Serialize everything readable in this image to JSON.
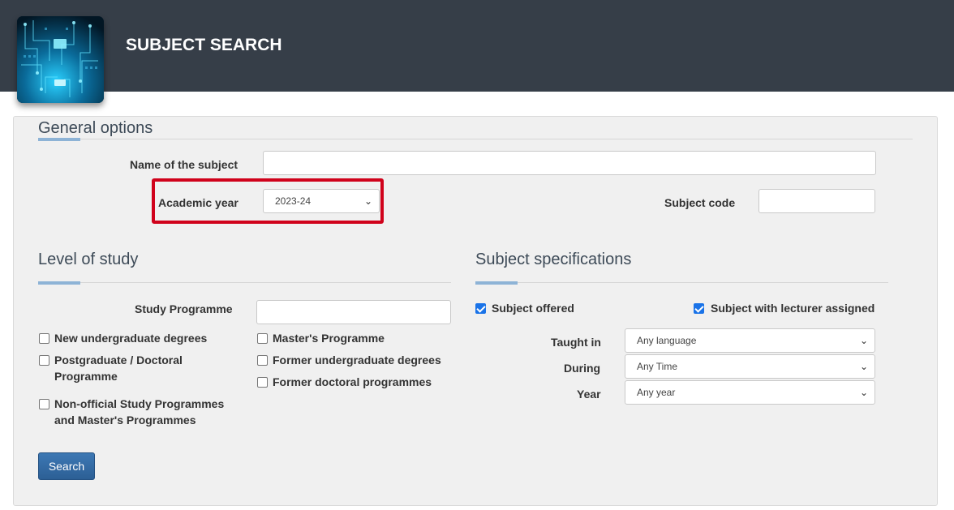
{
  "header": {
    "title": "SUBJECT SEARCH"
  },
  "general": {
    "title": "General options",
    "name_label": "Name of the subject",
    "name_value": "",
    "academic_year_label": "Academic year",
    "academic_year_value": "2023-24",
    "subject_code_label": "Subject code",
    "subject_code_value": ""
  },
  "level": {
    "title": "Level of study",
    "programme_label": "Study Programme",
    "programme_value": "",
    "options": [
      {
        "label": "New undergraduate degrees",
        "checked": false
      },
      {
        "label": "Postgraduate / Doctoral Programme",
        "checked": false
      },
      {
        "label": "Non-official Study Programmes and Master's Programmes",
        "checked": false
      },
      {
        "label": "Master's Programme",
        "checked": false
      },
      {
        "label": "Former undergraduate degrees",
        "checked": false
      },
      {
        "label": "Former doctoral programmes",
        "checked": false
      }
    ]
  },
  "specs": {
    "title": "Subject specifications",
    "offered_label": "Subject offered",
    "offered_checked": true,
    "lecturer_label": "Subject with lecturer assigned",
    "lecturer_checked": true,
    "taught_in_label": "Taught in",
    "taught_in_value": "Any language",
    "during_label": "During",
    "during_value": "Any Time",
    "year_label": "Year",
    "year_value": "Any year"
  },
  "actions": {
    "search_label": "Search"
  },
  "colors": {
    "header_bg": "#363e48",
    "accent": "#8db3d6",
    "highlight": "#d0021b",
    "button": "#2c5f95"
  }
}
